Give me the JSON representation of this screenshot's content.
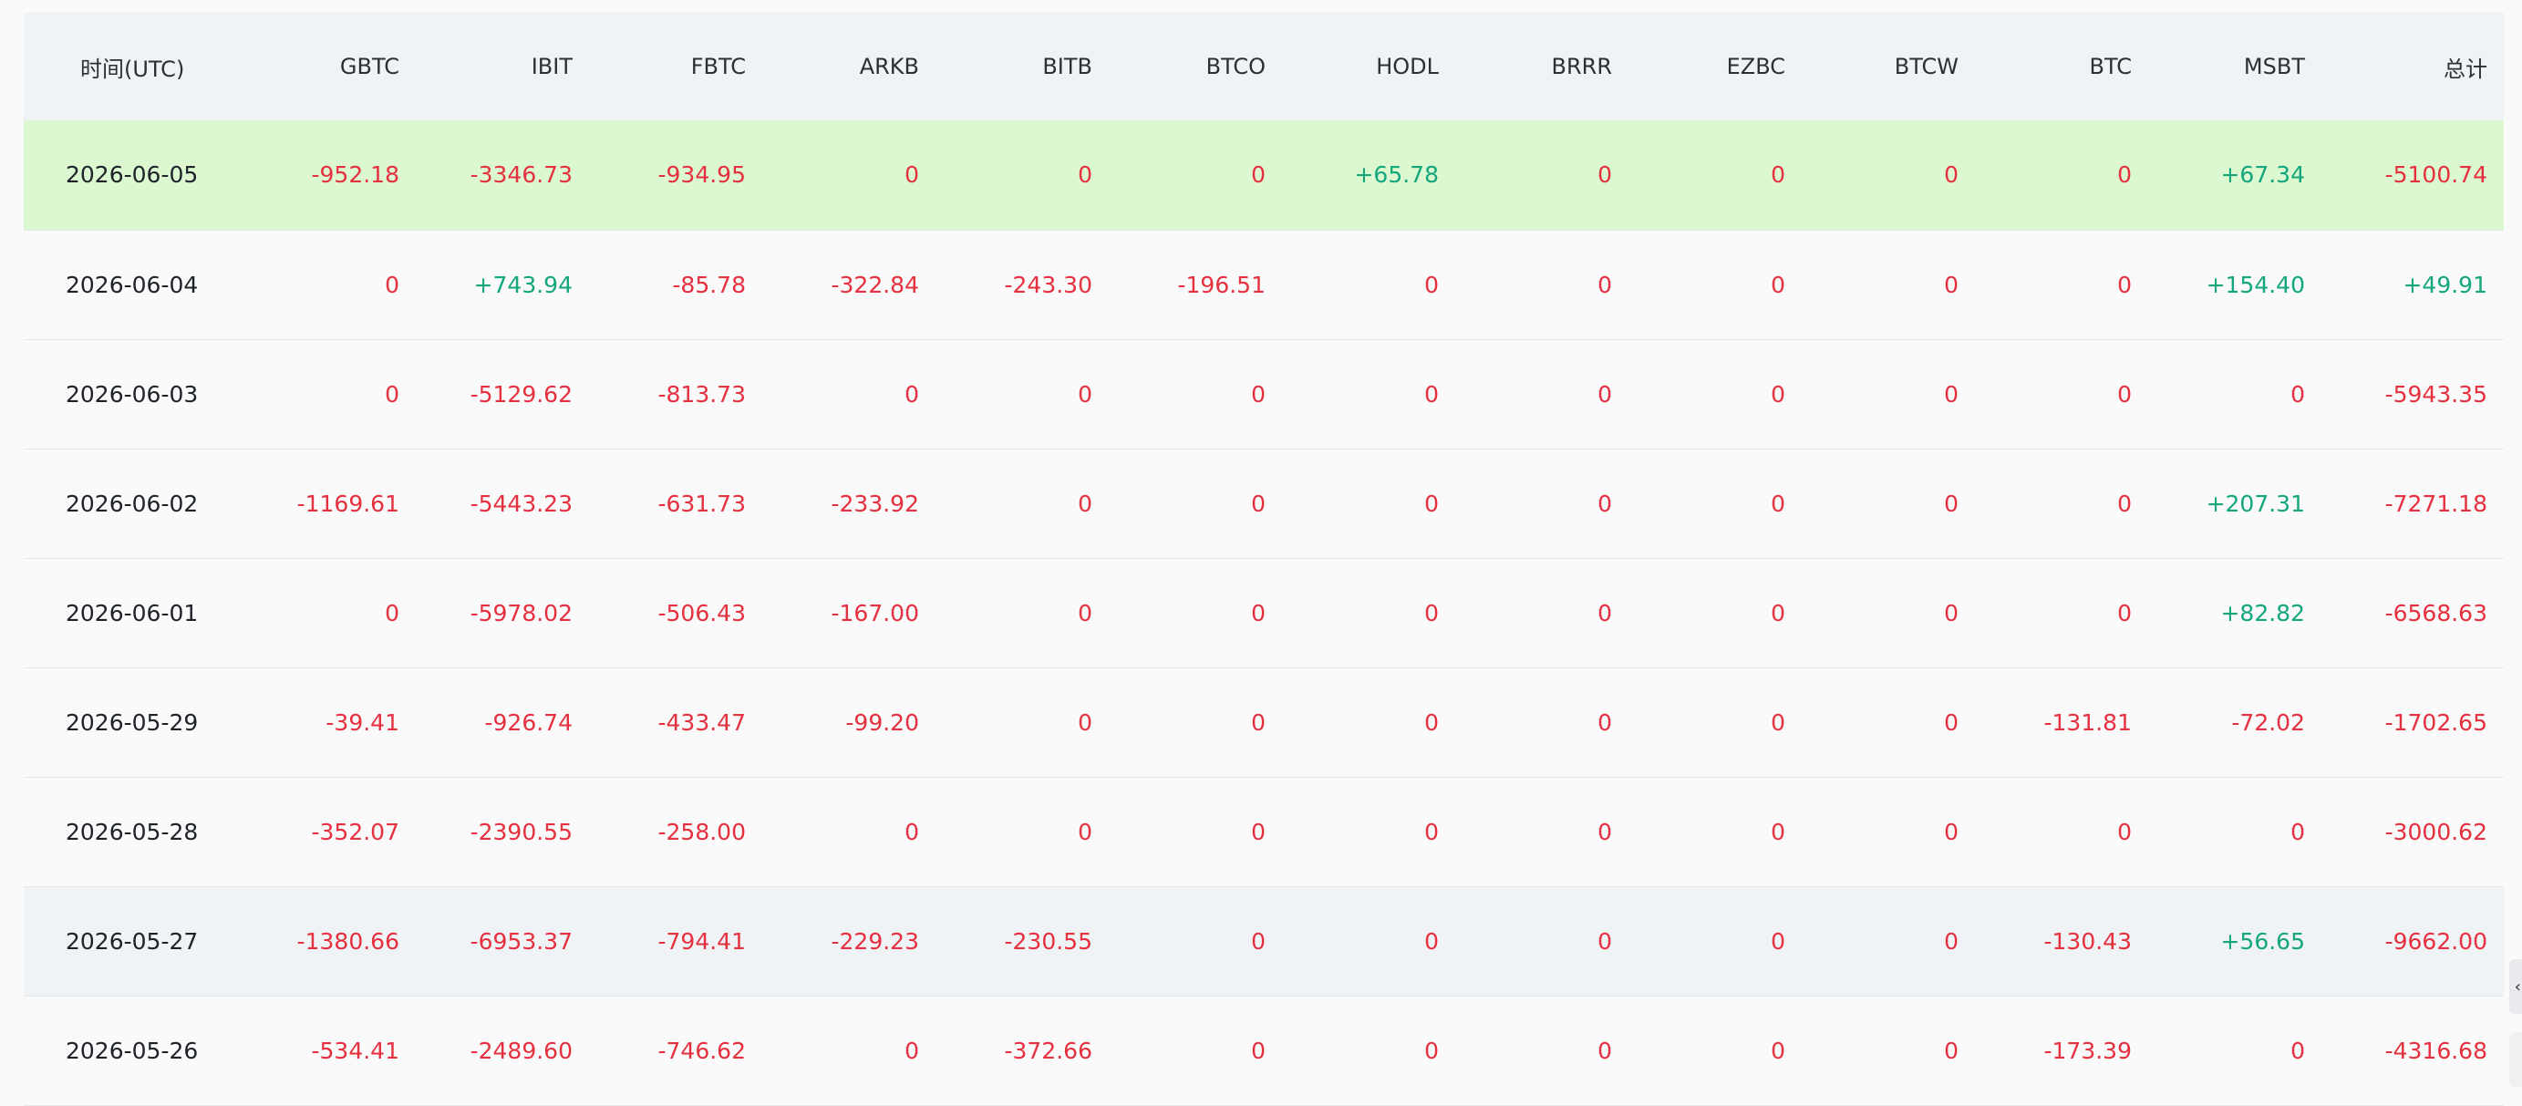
{
  "table": {
    "headers": [
      "时间(UTC)",
      "GBTC",
      "IBIT",
      "FBTC",
      "ARKB",
      "BITB",
      "BTCO",
      "HODL",
      "BRRR",
      "EZBC",
      "BTCW",
      "BTC",
      "MSBT",
      "总计"
    ],
    "rows": [
      {
        "date": "2026-06-05",
        "values": [
          "-952.18",
          "-3346.73",
          "-934.95",
          "0",
          "0",
          "0",
          "+65.78",
          "0",
          "0",
          "0",
          "0",
          "+67.34",
          "-5100.74"
        ]
      },
      {
        "date": "2026-06-04",
        "values": [
          "0",
          "+743.94",
          "-85.78",
          "-322.84",
          "-243.30",
          "-196.51",
          "0",
          "0",
          "0",
          "0",
          "0",
          "+154.40",
          "+49.91"
        ]
      },
      {
        "date": "2026-06-03",
        "values": [
          "0",
          "-5129.62",
          "-813.73",
          "0",
          "0",
          "0",
          "0",
          "0",
          "0",
          "0",
          "0",
          "0",
          "-5943.35"
        ]
      },
      {
        "date": "2026-06-02",
        "values": [
          "-1169.61",
          "-5443.23",
          "-631.73",
          "-233.92",
          "0",
          "0",
          "0",
          "0",
          "0",
          "0",
          "0",
          "+207.31",
          "-7271.18"
        ]
      },
      {
        "date": "2026-06-01",
        "values": [
          "0",
          "-5978.02",
          "-506.43",
          "-167.00",
          "0",
          "0",
          "0",
          "0",
          "0",
          "0",
          "0",
          "+82.82",
          "-6568.63"
        ]
      },
      {
        "date": "2026-05-29",
        "values": [
          "-39.41",
          "-926.74",
          "-433.47",
          "-99.20",
          "0",
          "0",
          "0",
          "0",
          "0",
          "0",
          "-131.81",
          "-72.02",
          "-1702.65"
        ]
      },
      {
        "date": "2026-05-28",
        "values": [
          "-352.07",
          "-2390.55",
          "-258.00",
          "0",
          "0",
          "0",
          "0",
          "0",
          "0",
          "0",
          "0",
          "0",
          "-3000.62"
        ]
      },
      {
        "date": "2026-05-27",
        "values": [
          "-1380.66",
          "-6953.37",
          "-794.41",
          "-229.23",
          "-230.55",
          "0",
          "0",
          "0",
          "0",
          "0",
          "-130.43",
          "+56.65",
          "-9662.00"
        ]
      },
      {
        "date": "2026-05-26",
        "values": [
          "-534.41",
          "-2489.60",
          "-746.62",
          "0",
          "-372.66",
          "0",
          "0",
          "0",
          "0",
          "0",
          "-173.39",
          "0",
          "-4316.68"
        ]
      }
    ]
  },
  "colors": {
    "negative": "#e5303f",
    "positive": "#14a67d",
    "highlight_row": "#dcf8d0",
    "header_bg": "#f0f3f6"
  },
  "icons": {
    "scroll_handle": "chevron-left-icon"
  }
}
